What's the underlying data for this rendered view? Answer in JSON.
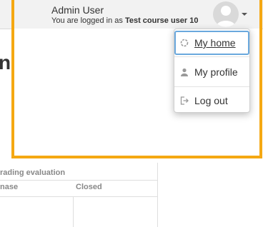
{
  "user": {
    "name": "Admin User",
    "logged_prefix": "You are logged in as ",
    "logged_as": "Test course user 10"
  },
  "page": {
    "heading_fragment": "n",
    "table": {
      "title": "rading evaluation",
      "col1": "nase",
      "col2": "Closed"
    }
  },
  "menu": {
    "items": [
      {
        "label": "My home",
        "icon": "home-icon"
      },
      {
        "label": "My profile",
        "icon": "user-icon"
      },
      {
        "label": "Log out",
        "icon": "logout-icon"
      }
    ]
  },
  "colors": {
    "highlight": "#f5a812",
    "focus": "#6aa8dd"
  }
}
